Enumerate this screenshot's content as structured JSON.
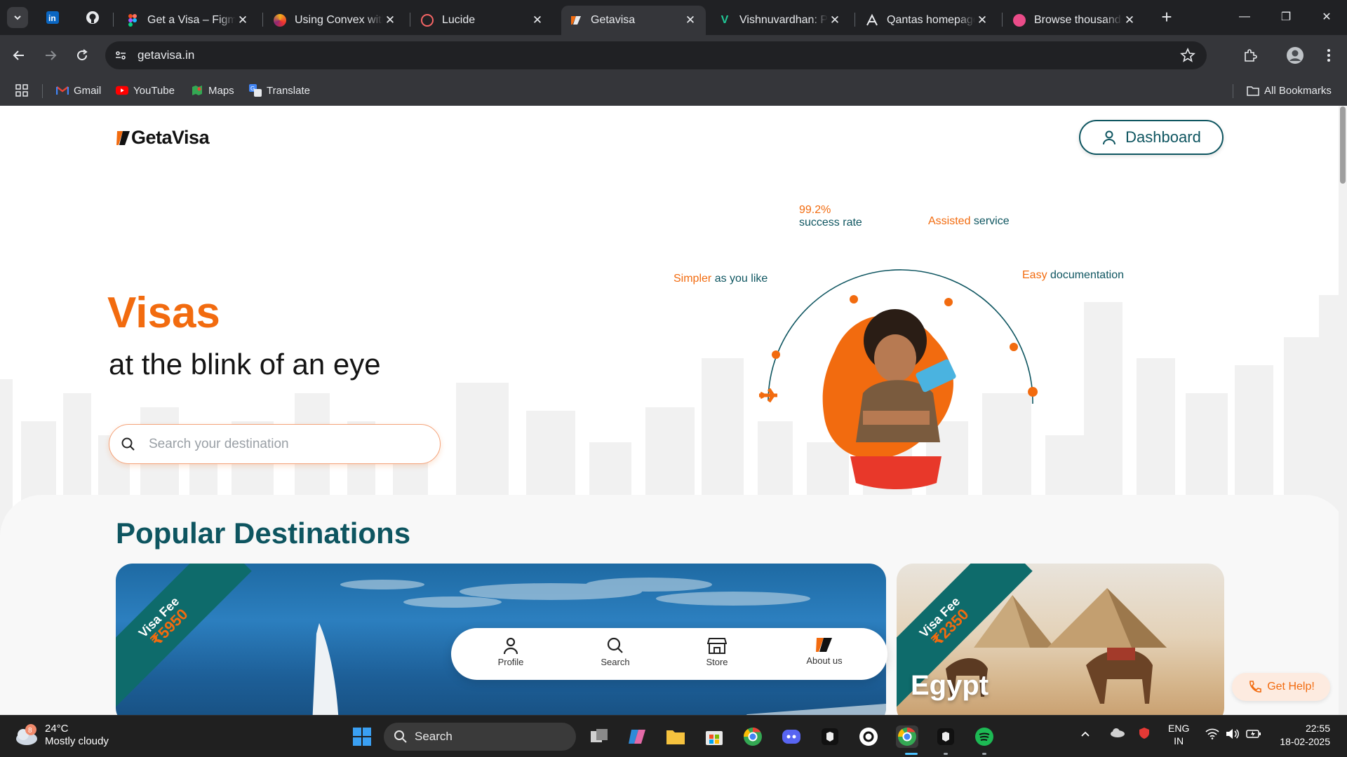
{
  "browser": {
    "tabs": [
      {
        "title": "",
        "favicon": "linkedin-icon",
        "pinned": true
      },
      {
        "title": "",
        "favicon": "github-icon",
        "pinned": true
      },
      {
        "title": "Get a Visa – Figma",
        "favicon": "figma-icon"
      },
      {
        "title": "Using Convex with",
        "favicon": "convex-icon"
      },
      {
        "title": "Lucide",
        "favicon": "lucide-icon"
      },
      {
        "title": "Getavisa",
        "favicon": "getavisa-icon",
        "active": true
      },
      {
        "title": "Vishnuvardhan: Pr",
        "favicon": "v-icon"
      },
      {
        "title": "Qantas homepage",
        "favicon": "qantas-icon"
      },
      {
        "title": "Browse thousands",
        "favicon": "dribbble-icon"
      }
    ],
    "address": "getavisa.in",
    "bookmarks": [
      {
        "label": "Gmail",
        "icon": "gmail-icon"
      },
      {
        "label": "YouTube",
        "icon": "youtube-icon"
      },
      {
        "label": "Maps",
        "icon": "maps-icon"
      },
      {
        "label": "Translate",
        "icon": "translate-icon"
      }
    ],
    "all_bookmarks": "All Bookmarks"
  },
  "site": {
    "logo": "GetaVisa",
    "dashboard_label": "Dashboard",
    "hero_title": "Visas",
    "hero_subtitle": "at the blink of an eye",
    "search_placeholder": "Search your destination",
    "features": {
      "rate_value": "99.2%",
      "rate_label": "success rate",
      "assisted_hl": "Assisted",
      "assisted_rest": "service",
      "simpler_hl": "Simpler",
      "simpler_rest": "as you like",
      "easy_hl": "Easy",
      "easy_rest": "documentation"
    },
    "popular_title": "Popular Destinations",
    "cards": [
      {
        "fee_label": "Visa Fee",
        "fee": "₹5950",
        "name": ""
      },
      {
        "fee_label": "Visa Fee",
        "fee": "₹2350",
        "name": "Egypt"
      }
    ],
    "bottom_nav": [
      {
        "label": "Profile",
        "icon": "user-icon"
      },
      {
        "label": "Search",
        "icon": "search-icon"
      },
      {
        "label": "Store",
        "icon": "store-icon"
      },
      {
        "label": "About us",
        "icon": "getavisa-logo-icon"
      }
    ],
    "help_label": "Get Help!",
    "colors": {
      "accent": "#f26b0f",
      "primary": "#0e5560"
    }
  },
  "taskbar": {
    "weather_temp": "24°C",
    "weather_desc": "Mostly cloudy",
    "weather_badge": "8",
    "search_label": "Search",
    "lang_1": "ENG",
    "lang_2": "IN",
    "time": "22:55",
    "date": "18-02-2025"
  }
}
